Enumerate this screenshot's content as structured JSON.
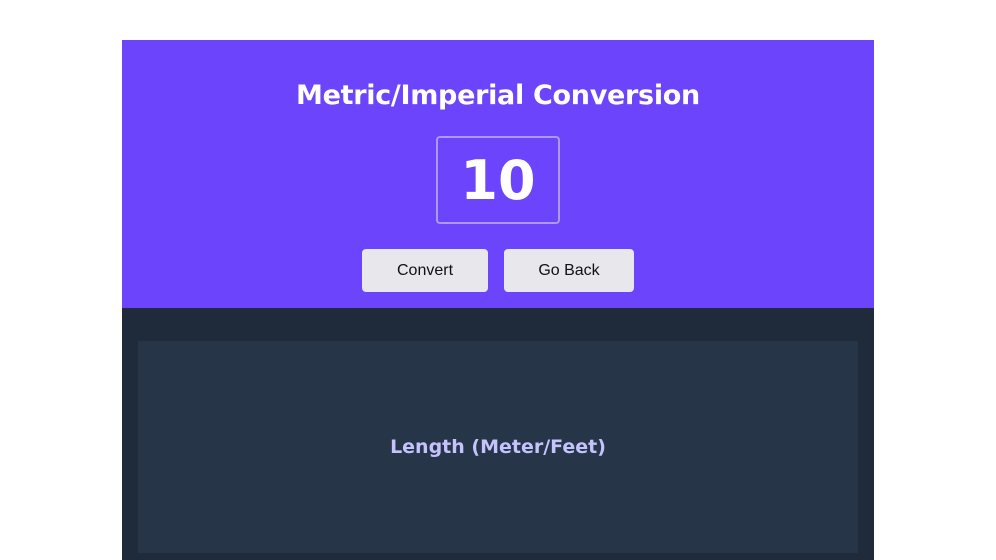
{
  "header": {
    "title": "Metric/Imperial Conversion"
  },
  "input": {
    "value": "10"
  },
  "buttons": {
    "convert_label": "Convert",
    "back_label": "Go Back"
  },
  "results": {
    "cards": [
      {
        "title": "Length (Meter/Feet)"
      }
    ]
  },
  "colors": {
    "hero_bg": "#6c44fc",
    "results_bg": "#1f2a3a",
    "card_bg": "#263548",
    "card_title": "#c5c3fb",
    "button_bg": "#e8e7ec"
  }
}
